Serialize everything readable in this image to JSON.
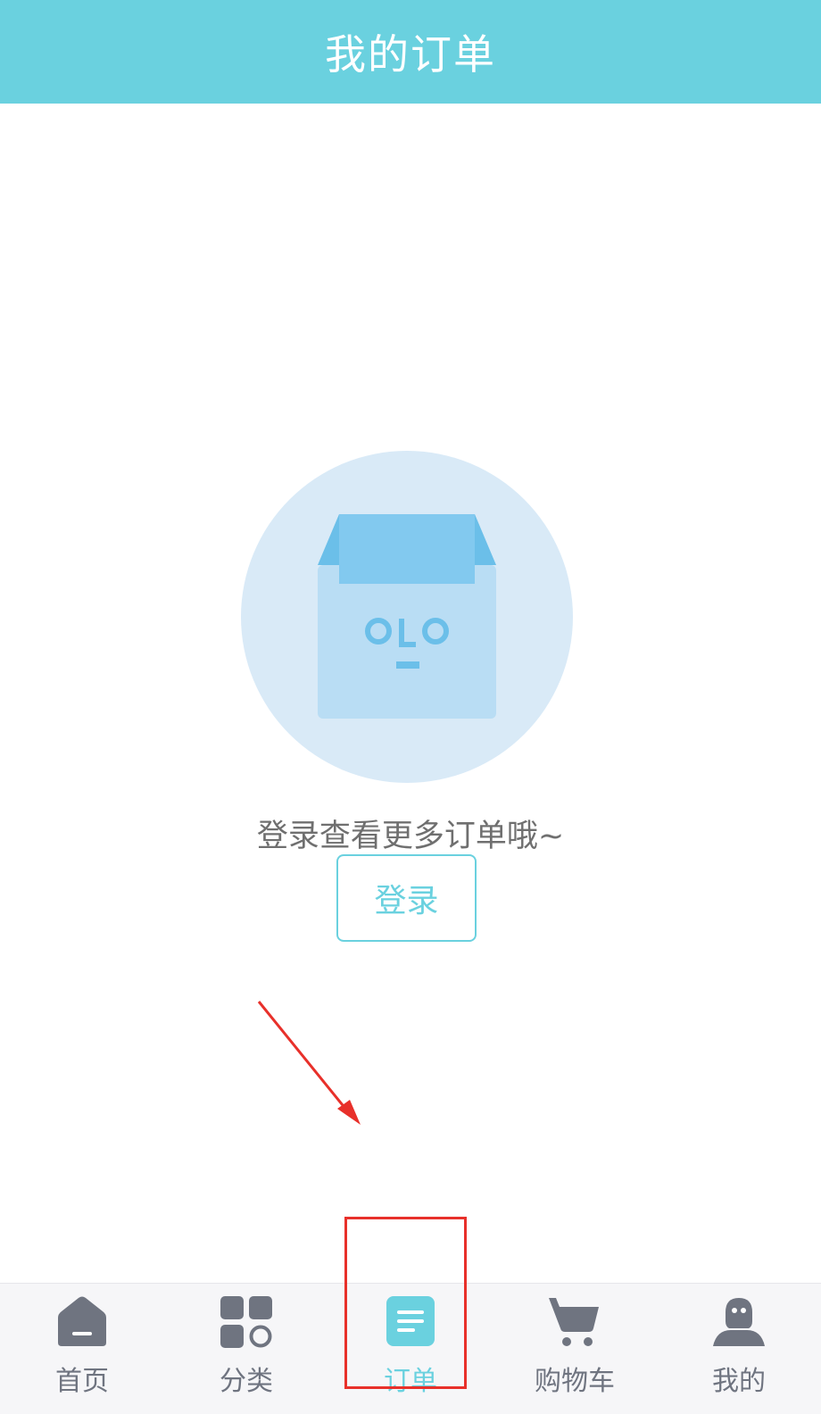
{
  "header": {
    "title": "我的订单"
  },
  "empty_state": {
    "illustration_icon": "empty-box-face-icon",
    "message": "登录查看更多订单哦~",
    "login_button_label": "登录"
  },
  "tabbar": {
    "active_tab": "订单",
    "tabs": [
      {
        "label": "首页",
        "icon": "home-icon"
      },
      {
        "label": "分类",
        "icon": "category-grid-icon"
      },
      {
        "label": "订单",
        "icon": "order-list-icon"
      },
      {
        "label": "购物车",
        "icon": "shopping-cart-icon"
      },
      {
        "label": "我的",
        "icon": "profile-icon"
      }
    ]
  },
  "colors": {
    "accent": "#6ad1df",
    "inactive": "#6f7480",
    "annotation_red": "#e8302a",
    "illustration_circle": "#d9eaf7",
    "illustration_box": "#b9ddf4"
  }
}
